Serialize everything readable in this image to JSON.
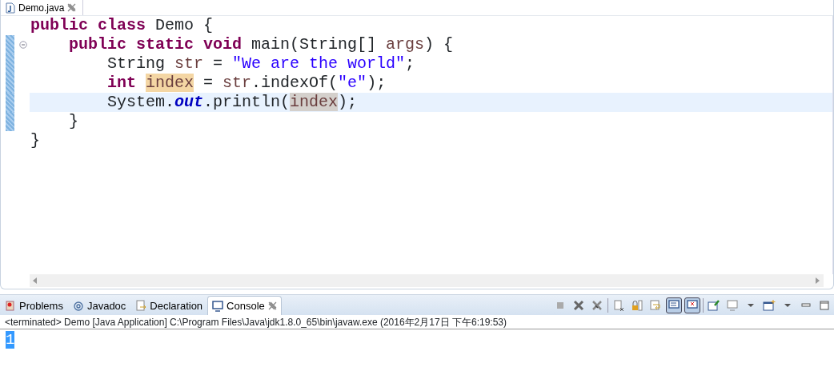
{
  "editor": {
    "tab": {
      "label": "Demo.java"
    },
    "lines": [
      {
        "changed": false,
        "fold": false,
        "current": false,
        "tokens": [
          {
            "kind": "keyword",
            "t": "public "
          },
          {
            "kind": "keyword",
            "t": "class "
          },
          {
            "kind": "plain",
            "t": "Demo {"
          }
        ]
      },
      {
        "changed": true,
        "fold": true,
        "current": false,
        "tokens": [
          {
            "kind": "keyword",
            "t": "    public "
          },
          {
            "kind": "keyword",
            "t": "static "
          },
          {
            "kind": "keyword",
            "t": "void "
          },
          {
            "kind": "plain",
            "t": "main(String[] "
          },
          {
            "kind": "variable",
            "t": "args"
          },
          {
            "kind": "plain",
            "t": ") {"
          }
        ]
      },
      {
        "changed": true,
        "fold": false,
        "current": false,
        "tokens": [
          {
            "kind": "plain",
            "t": "        String "
          },
          {
            "kind": "variable",
            "t": "str"
          },
          {
            "kind": "plain",
            "t": " = "
          },
          {
            "kind": "string",
            "t": "\"We are the world\""
          },
          {
            "kind": "plain",
            "t": ";"
          }
        ]
      },
      {
        "changed": true,
        "fold": false,
        "current": false,
        "tokens": [
          {
            "kind": "keyword",
            "t": "        int "
          },
          {
            "kind": "write-occurrence",
            "t": "index"
          },
          {
            "kind": "plain",
            "t": " = "
          },
          {
            "kind": "variable",
            "t": "str"
          },
          {
            "kind": "plain",
            "t": ".indexOf("
          },
          {
            "kind": "string",
            "t": "\"e\""
          },
          {
            "kind": "plain",
            "t": ");"
          }
        ]
      },
      {
        "changed": true,
        "fold": false,
        "current": true,
        "tokens": [
          {
            "kind": "plain",
            "t": "        System."
          },
          {
            "kind": "field",
            "t": "out"
          },
          {
            "kind": "plain",
            "t": ".println("
          },
          {
            "kind": "read-occurrence",
            "t": "index"
          },
          {
            "kind": "plain",
            "t": ");"
          }
        ]
      },
      {
        "changed": true,
        "fold": false,
        "current": false,
        "tokens": [
          {
            "kind": "plain",
            "t": "    }"
          }
        ]
      },
      {
        "changed": false,
        "fold": false,
        "current": false,
        "tokens": [
          {
            "kind": "plain",
            "t": "}"
          }
        ]
      }
    ]
  },
  "panel": {
    "tabs": [
      {
        "label": "Problems",
        "kind": "problems",
        "selected": false
      },
      {
        "label": "Javadoc",
        "kind": "javadoc",
        "selected": false
      },
      {
        "label": "Declaration",
        "kind": "declaration",
        "selected": false
      },
      {
        "label": "Console",
        "kind": "console",
        "selected": true
      }
    ],
    "toolbar": [
      {
        "kind": "terminate",
        "on": false
      },
      {
        "kind": "remove",
        "on": false
      },
      {
        "kind": "remove-all",
        "on": false
      },
      {
        "kind": "separator"
      },
      {
        "kind": "clear",
        "on": false
      },
      {
        "kind": "scroll-lock",
        "on": false
      },
      {
        "kind": "word-wrap",
        "on": false
      },
      {
        "kind": "show-stdout",
        "on": true
      },
      {
        "kind": "show-stderr",
        "on": true
      },
      {
        "kind": "separator"
      },
      {
        "kind": "pin",
        "on": false
      },
      {
        "kind": "display",
        "on": false
      },
      {
        "kind": "dropdown",
        "on": false
      },
      {
        "kind": "open-console",
        "on": false
      },
      {
        "kind": "dropdown",
        "on": false
      },
      {
        "kind": "minimize",
        "on": false
      },
      {
        "kind": "maximize",
        "on": false
      }
    ],
    "header": "<terminated> Demo [Java Application] C:\\Program Files\\Java\\jdk1.8.0_65\\bin\\javaw.exe (2016年2月17日 下午6:19:53)",
    "output": [
      {
        "text": "1",
        "selected": true
      }
    ]
  }
}
